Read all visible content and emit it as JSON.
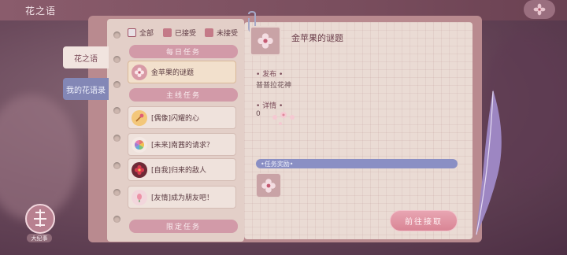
{
  "header": {
    "title": "花之语"
  },
  "side_tabs": [
    {
      "label": "花之语"
    },
    {
      "label": "我的花语录"
    }
  ],
  "filters": [
    {
      "label": "全部",
      "checked": true
    },
    {
      "label": "已接受",
      "checked": false
    },
    {
      "label": "未接受",
      "checked": false
    }
  ],
  "sections": {
    "daily": "每日任务",
    "main": "主线任务",
    "limited": "限定任务"
  },
  "quests": {
    "daily": [
      {
        "label": "金苹果的谜题",
        "icon": "flower-icon",
        "selected": true
      }
    ],
    "main": [
      {
        "label": "[偶像]闪耀的心",
        "icon": "wand-icon"
      },
      {
        "label": "[未来]南茜的请求？",
        "icon": "wheel-icon"
      },
      {
        "label": "[自我]归来的敌人",
        "icon": "red-flower-icon"
      },
      {
        "label": "[友情]成为朋友吧！",
        "icon": "bud-icon"
      }
    ]
  },
  "detail": {
    "title": "金苹果的谜题",
    "publisher_label": "发布",
    "publisher": "普普拉花神",
    "info_label": "详情",
    "info": "0",
    "reward_label": "任务奖励",
    "go_button": "前往接取"
  },
  "badge": {
    "label": "大纪事"
  },
  "colors": {
    "accent": "#d98595",
    "reward_bar": "#8a8fc4",
    "tab_active": "#8387b6"
  }
}
